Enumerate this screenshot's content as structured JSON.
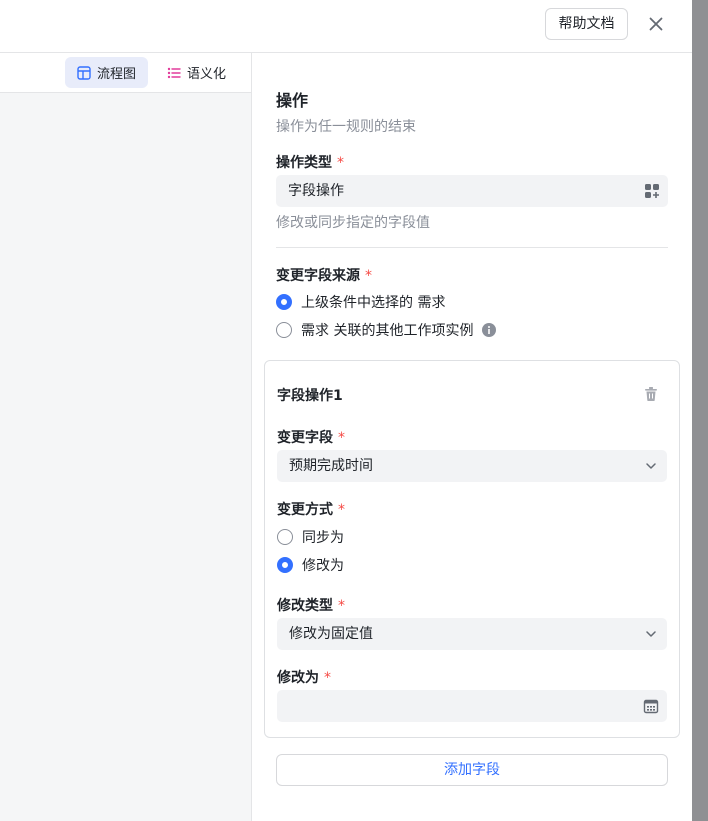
{
  "header": {
    "help_label": "帮助文档",
    "close_icon": "close-icon"
  },
  "left_toolbar": {
    "views": [
      {
        "label": "流程图",
        "icon": "flowchart-icon",
        "active": true
      },
      {
        "label": "语义化",
        "icon": "list-icon",
        "active": false
      }
    ]
  },
  "operation": {
    "title": "操作",
    "subtitle": "操作为任一规则的结束",
    "type_label": "操作类型",
    "type_value": "字段操作",
    "type_icon": "apps-add-icon",
    "type_desc": "修改或同步指定的字段值",
    "source_label": "变更字段来源",
    "source_options": [
      {
        "label": "上级条件中选择的 需求",
        "checked": true
      },
      {
        "label": "需求 关联的其他工作项实例",
        "checked": false,
        "has_info": true
      }
    ]
  },
  "field_op": {
    "title": "字段操作1",
    "delete_icon": "trash-icon",
    "change_field_label": "变更字段",
    "change_field_value": "预期完成时间",
    "change_mode_label": "变更方式",
    "change_mode_options": [
      {
        "label": "同步为",
        "checked": false
      },
      {
        "label": "修改为",
        "checked": true
      }
    ],
    "modify_type_label": "修改类型",
    "modify_type_value": "修改为固定值",
    "modify_to_label": "修改为",
    "modify_to_value": "",
    "date_icon": "calendar-icon"
  },
  "add_field_label": "添加字段",
  "required_mark": "*",
  "colors": {
    "accent": "#3370ff",
    "required": "#f54a45",
    "field_bg": "#f2f3f5",
    "active_view_bg": "#e8ecfa"
  }
}
